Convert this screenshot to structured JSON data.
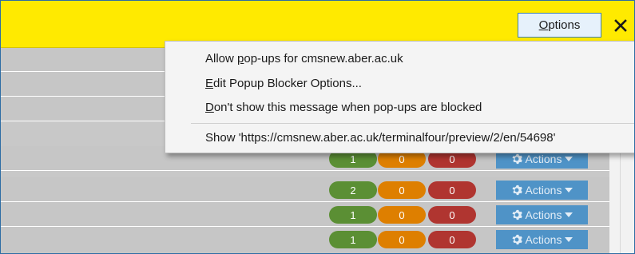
{
  "notification_bar": {
    "options_label": "Options",
    "options_mnemonic": "O",
    "options_rest": "ptions",
    "close_glyph": "✕",
    "color": "#ffea00"
  },
  "popup_menu": {
    "items": [
      {
        "before": "Allow ",
        "mnemonic": "p",
        "after": "op-ups for cmsnew.aber.ac.uk"
      },
      {
        "before": "",
        "mnemonic": "E",
        "after": "dit Popup Blocker Options..."
      },
      {
        "before": "",
        "mnemonic": "D",
        "after": "on't show this message when pop-ups are blocked"
      },
      {
        "before": "Show 'https://cmsnew.aber.ac.uk/terminalfour/preview/2/en/54698'",
        "mnemonic": "",
        "after": ""
      }
    ]
  },
  "table": {
    "rows": [
      {
        "green": "",
        "orange": "",
        "red": "",
        "action": ""
      },
      {
        "green": "",
        "orange": "",
        "red": "",
        "action": ""
      },
      {
        "green": "",
        "orange": "",
        "red": "",
        "action": ""
      },
      {
        "green": "1",
        "orange": "0",
        "red": "0",
        "action": "Actions"
      },
      {
        "green": "2",
        "orange": "0",
        "red": "0",
        "action": "Actions"
      },
      {
        "green": "1",
        "orange": "0",
        "red": "0",
        "action": "Actions"
      },
      {
        "green": "1",
        "orange": "0",
        "red": "0",
        "action": "Actions"
      }
    ],
    "colors": {
      "green": "#5b8f34",
      "orange": "#de7f00",
      "red": "#b03530",
      "actions": "#4f93c7"
    }
  },
  "icons": {
    "close": "close-icon",
    "cog": "cog-icon",
    "caret": "caret-down-icon"
  }
}
